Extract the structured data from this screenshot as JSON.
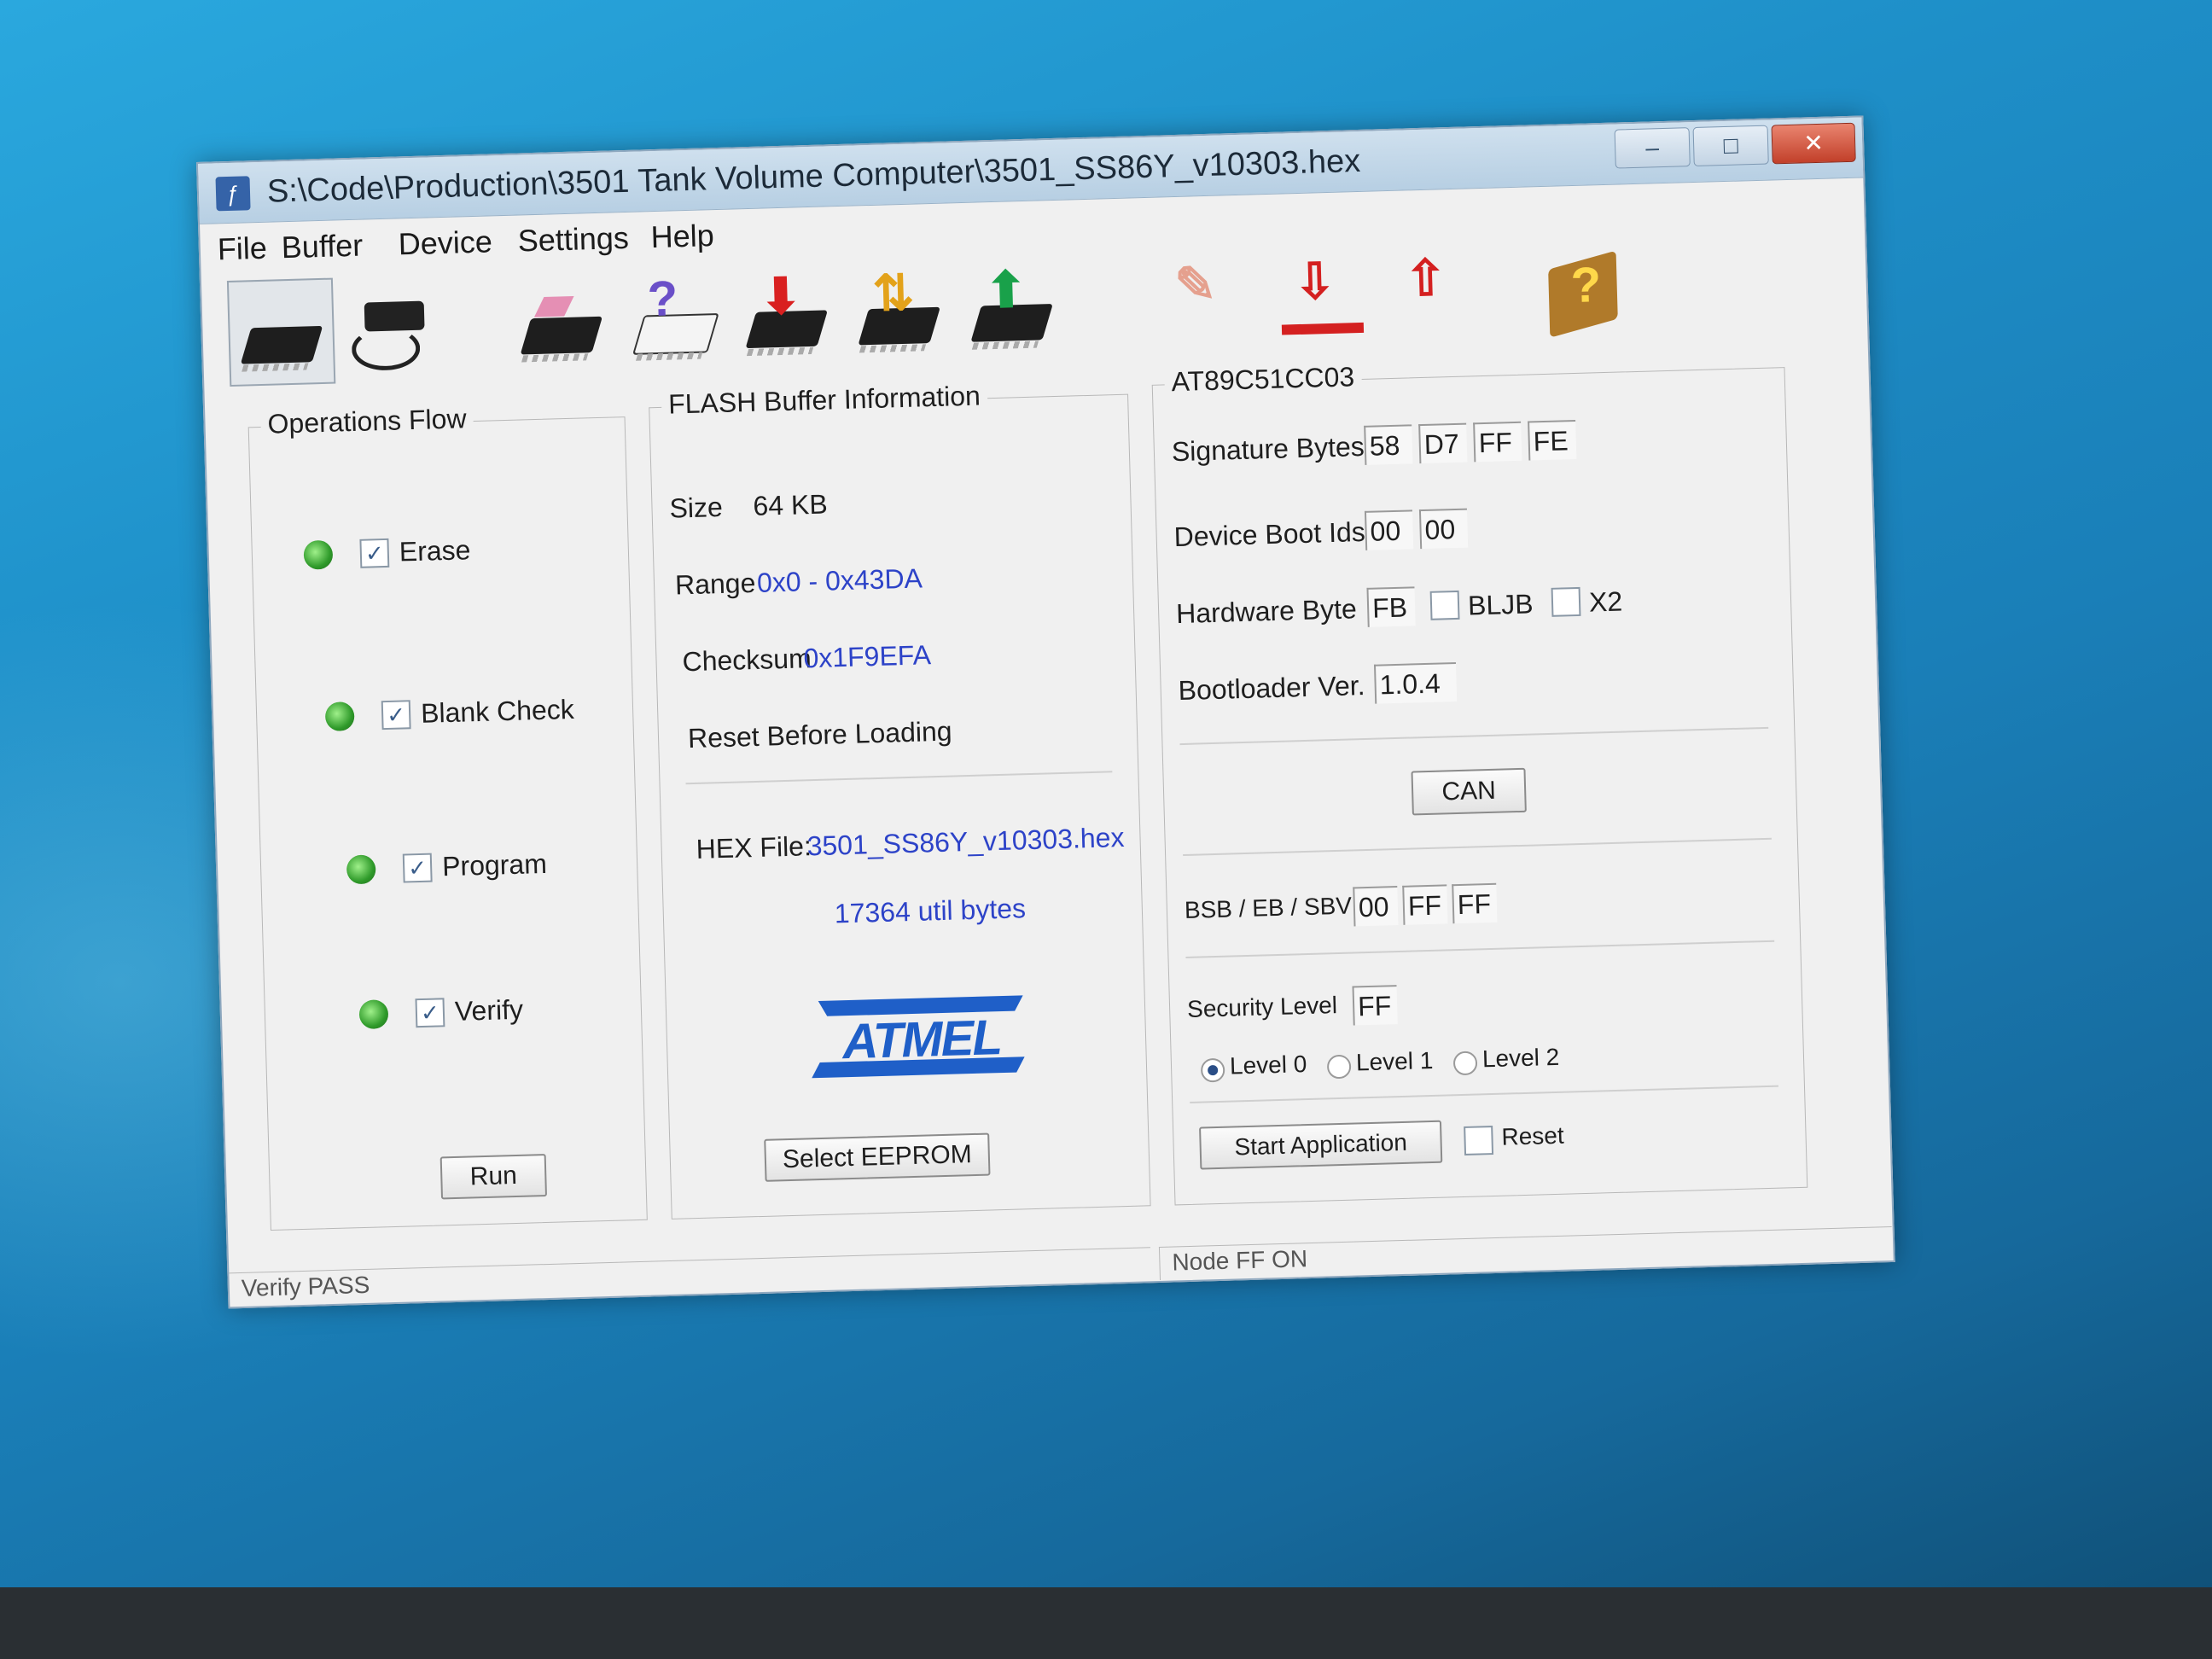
{
  "window": {
    "title": "S:\\Code\\Production\\3501 Tank Volume Computer\\3501_SS86Y_v10303.hex",
    "controls": {
      "minimize": "–",
      "maximize": "□",
      "close": "✕"
    }
  },
  "menu": [
    "File",
    "Buffer",
    "Device",
    "Settings",
    "Help"
  ],
  "toolbar": {
    "icons": [
      "select-device-icon",
      "usb-connect-icon",
      "erase-icon",
      "blank-check-icon",
      "program-icon",
      "verify-icon",
      "read-icon",
      "edit-buffer-icon",
      "load-hex-icon",
      "save-hex-icon",
      "help-book-icon"
    ]
  },
  "operations_flow": {
    "legend": "Operations Flow",
    "items": [
      {
        "label": "Erase",
        "checked": "✓"
      },
      {
        "label": "Blank Check",
        "checked": "✓"
      },
      {
        "label": "Program",
        "checked": "✓"
      },
      {
        "label": "Verify",
        "checked": "✓"
      }
    ],
    "run_label": "Run"
  },
  "flash_buffer": {
    "legend": "FLASH Buffer Information",
    "size_label": "Size",
    "size_value": "64 KB",
    "range_label": "Range",
    "range_value": "0x0 - 0x43DA",
    "checksum_label": "Checksum",
    "checksum_value": "0x1F9EFA",
    "reset_before_loading": "Reset Before Loading",
    "hex_file_label": "HEX File:",
    "hex_file_value": "3501_SS86Y_v10303.hex",
    "util_bytes": "17364 util bytes",
    "logo_text": "ATMEL",
    "select_eeprom_label": "Select EEPROM"
  },
  "device": {
    "legend": "AT89C51CC03",
    "signature_label": "Signature Bytes",
    "signature_bytes": [
      "58",
      "D7",
      "FF",
      "FE"
    ],
    "boot_ids_label": "Device Boot Ids",
    "boot_ids": [
      "00",
      "00"
    ],
    "hardware_byte_label": "Hardware Byte",
    "hardware_byte": "FB",
    "bljb_label": "BLJB",
    "x2_label": "X2",
    "bootloader_label": "Bootloader Ver.",
    "bootloader_version": "1.0.4",
    "can_label": "CAN",
    "bsb_label": "BSB / EB / SBV",
    "bsb_values": [
      "00",
      "FF",
      "FF"
    ],
    "security_label": "Security Level",
    "security_value": "FF",
    "levels": [
      "Level 0",
      "Level 1",
      "Level 2"
    ],
    "selected_level": "Level 0",
    "start_application_label": "Start Application",
    "reset_label": "Reset"
  },
  "status": {
    "left": "Verify PASS",
    "right": "Node FF ON"
  }
}
